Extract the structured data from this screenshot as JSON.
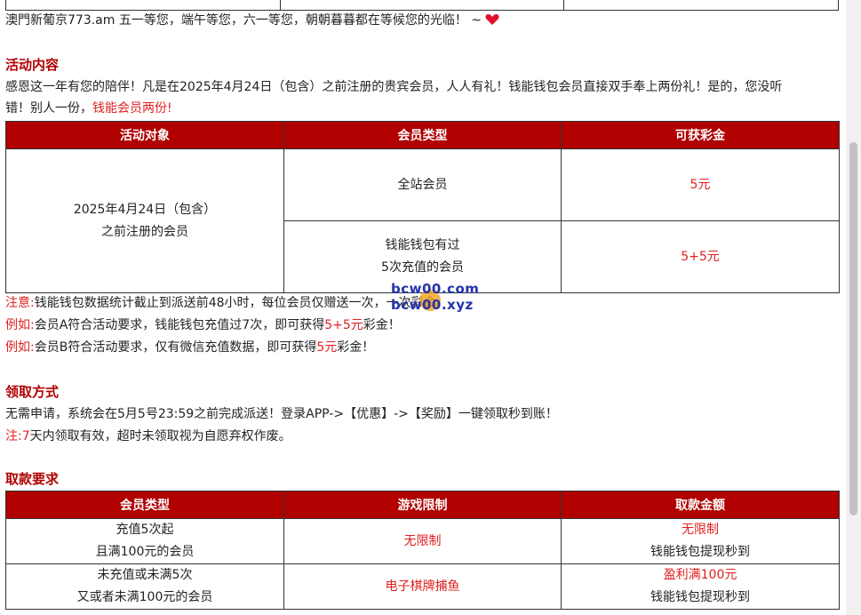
{
  "intro": {
    "text": "澳門新葡京773.am 五一等您，端午等您，六一等您，朝朝暮暮都在等候您的光临！ ~"
  },
  "activity": {
    "heading": "活动内容",
    "desc_line1": "感恩这一年有您的陪伴！凡是在2025年4月24日（包含）之前注册的贵宾会员，人人有礼！钱能钱包会员直接双手奉上两份礼！是的，您没听",
    "desc_line2_pre": "错！别人一份，",
    "desc_line2_red": "钱能会员两份!",
    "table": {
      "headers": [
        "活动对象",
        "会员类型",
        "可获彩金"
      ],
      "target_line1": "2025年4月24日（包含）",
      "target_line2": "之前注册的会员",
      "rows": [
        {
          "type_line1": "全站会员",
          "type_line2": "",
          "bonus": "5元"
        },
        {
          "type_line1": "钱能钱包有过",
          "type_line2": "5次充值的会员",
          "bonus": "5+5元"
        }
      ]
    },
    "note_label": "注意:",
    "note_text": "钱能钱包数据统计截止到派送前48小时，每位会员仅赠送一次，一次",
    "note_tail": "彩金。",
    "ex1_label": "例如:",
    "ex1_pre": "会员A符合活动要求，钱能钱包充值过7次，即可获得",
    "ex1_red": "5+5元",
    "ex1_post": "彩金！",
    "ex2_label": "例如:",
    "ex2_pre": "会员B符合活动要求，仅有微信充值数据，即可获得",
    "ex2_red": "5元",
    "ex2_post": "彩金！"
  },
  "claim": {
    "heading": "领取方式",
    "line1": "无需申请，系统会在5月5号23:59之前完成派送！登录APP->【优惠】->【奖励】一键领取秒到账！",
    "note_label": "注:",
    "note_red": "7",
    "note_text": "天内领取有效，超时未领取视为自愿弃权作废。"
  },
  "withdraw": {
    "heading": "取款要求",
    "headers": [
      "会员类型",
      "游戏限制",
      "取款金额"
    ],
    "rows": [
      {
        "type_line1": "充值5次起",
        "type_line2": "且满100元的会员",
        "limit": "无限制",
        "amount_line1": "无限制",
        "amount_line2": "钱能钱包提现秒到"
      },
      {
        "type_line1": "未充值或未满5次",
        "type_line2": "又或者未满100元的会员",
        "limit": "电子棋牌捕鱼",
        "amount_line1": "盈利满100元",
        "amount_line2": "钱能钱包提现秒到"
      }
    ]
  },
  "watermark": {
    "line1": "bcw00.com",
    "line2": "bcw00.xyz"
  },
  "colors": {
    "header_bg": "#b00000",
    "accent_red": "#e02020",
    "heading_red": "#b00000"
  }
}
